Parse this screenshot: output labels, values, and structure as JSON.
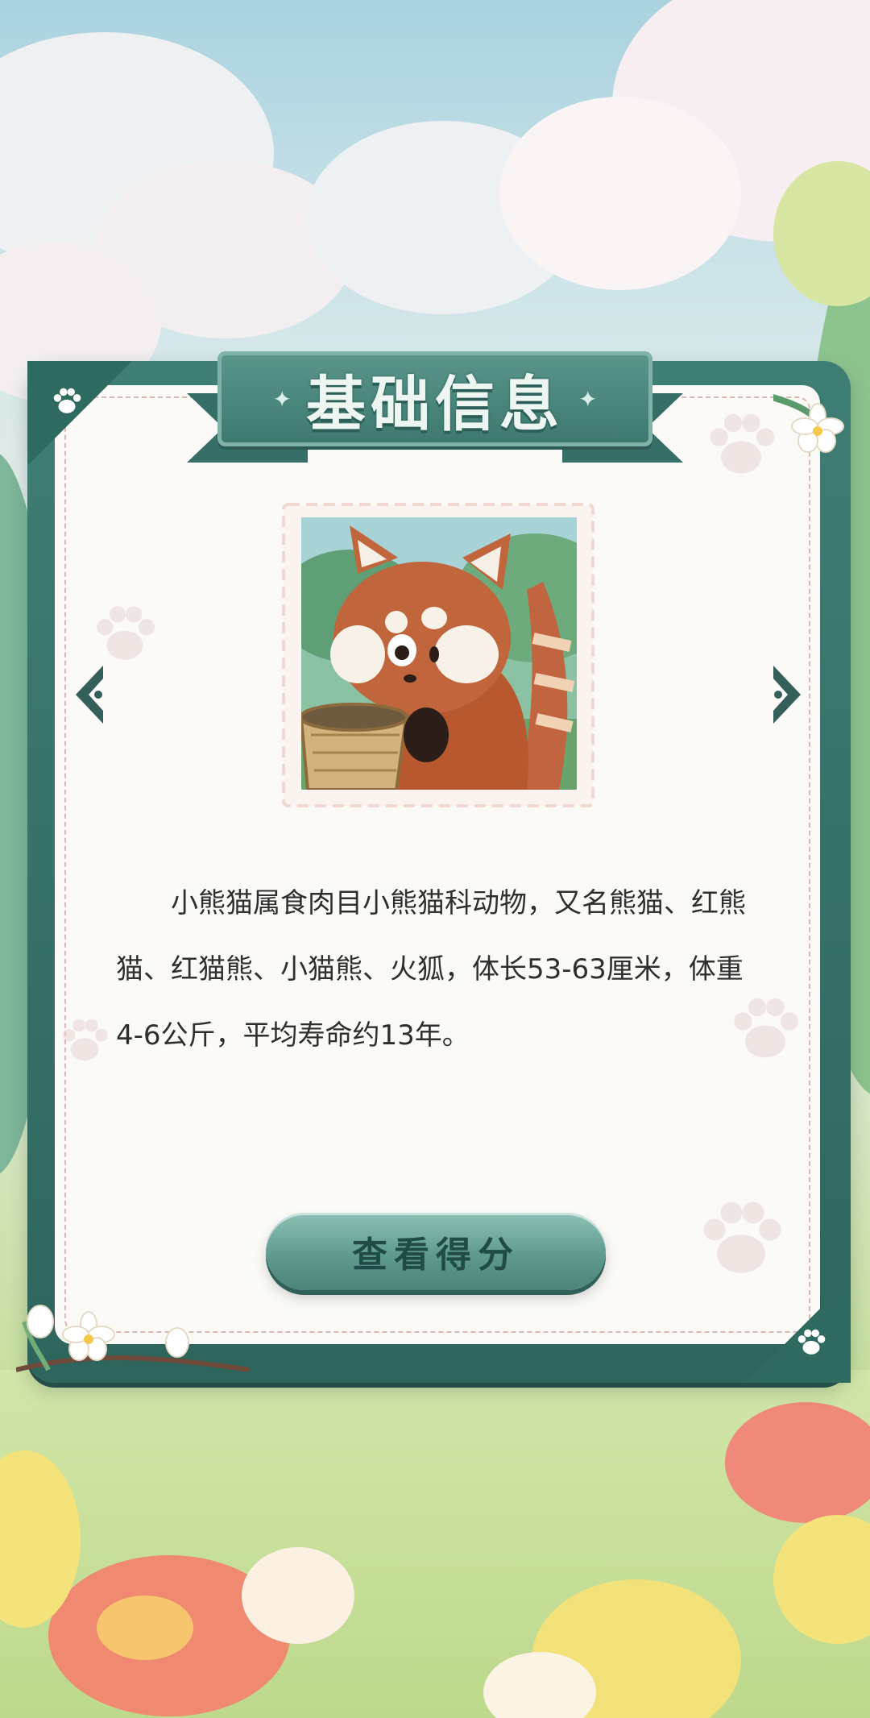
{
  "header": {
    "title": "基础信息"
  },
  "stamp": {
    "image_subject": "red-panda"
  },
  "description": "小熊猫属食肉目小熊猫科动物，又名熊猫、红熊猫、红猫熊、小猫熊、火狐，体长53-63厘米，体重4-6公斤，平均寿命约13年。",
  "actions": {
    "view_score_label": "查看得分"
  },
  "nav": {
    "prev_icon": "chevron-left-icon",
    "next_icon": "chevron-right-icon"
  },
  "colors": {
    "frame": "#3f7e74",
    "frame_dark": "#2e655d",
    "paper": "#fbfaf7",
    "text": "#2f2f2f",
    "button": "#5f9a8f"
  }
}
